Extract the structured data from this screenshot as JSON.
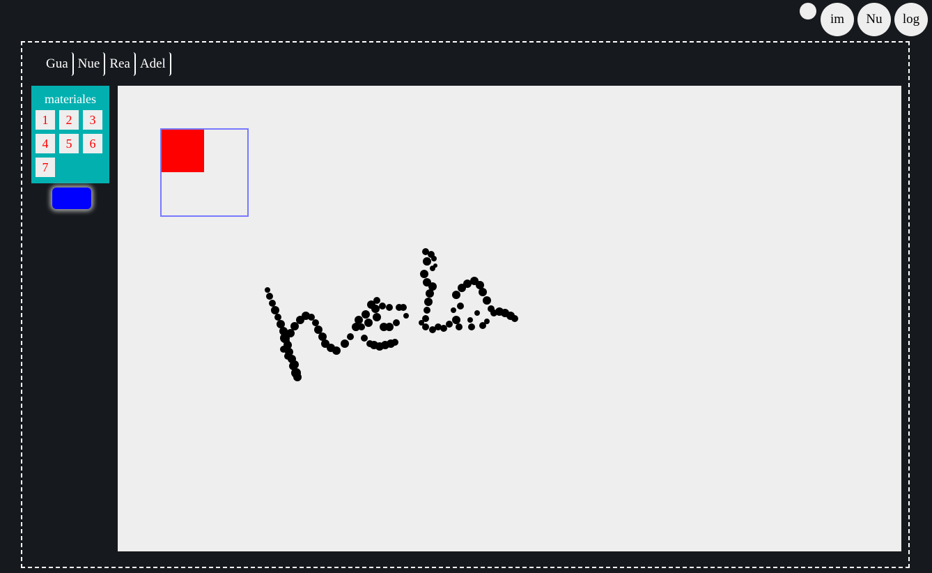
{
  "header": {
    "buttons": [
      {
        "label": "im"
      },
      {
        "label": "Nu"
      },
      {
        "label": "log"
      }
    ]
  },
  "menu": {
    "items": [
      {
        "label": "Gua"
      },
      {
        "label": "Nue"
      },
      {
        "label": "Rea"
      },
      {
        "label": "Adel"
      }
    ]
  },
  "materials": {
    "title": "materiales",
    "items": [
      "1",
      "2",
      "3",
      "4",
      "5",
      "6",
      "7"
    ]
  },
  "colors": {
    "selected_color": "#0000ff",
    "materials_bg": "#03b0b0",
    "shape_fill": "#ff0000",
    "selection_outline": "#7777ff",
    "canvas_bg": "#eeeeee",
    "page_bg": "#16191d"
  }
}
